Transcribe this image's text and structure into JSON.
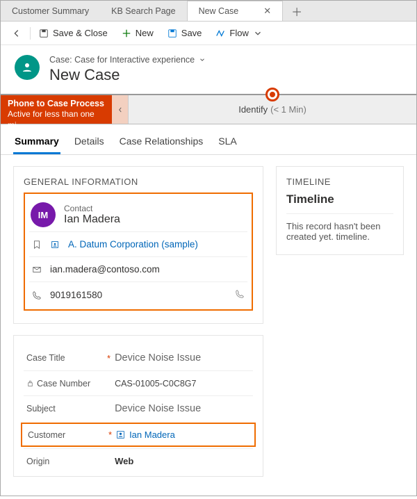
{
  "tabs": {
    "t1": "Customer Summary",
    "t2": "KB Search Page",
    "t3": "New Case"
  },
  "commands": {
    "save_close": "Save & Close",
    "new": "New",
    "save": "Save",
    "flow": "Flow"
  },
  "header": {
    "breadcrumb": "Case: Case for Interactive experience",
    "title": "New Case"
  },
  "process": {
    "name": "Phone to Case Process",
    "status": "Active for less than one mi...",
    "stage_label": "Identify",
    "stage_time": "(< 1 Min)"
  },
  "inner_tabs": {
    "summary": "Summary",
    "details": "Details",
    "rel": "Case Relationships",
    "sla": "SLA"
  },
  "general": {
    "title": "GENERAL INFORMATION",
    "contact_label": "Contact",
    "contact_initials": "IM",
    "contact_name": "Ian Madera",
    "company": "A. Datum Corporation (sample)",
    "email": "ian.madera@contoso.com",
    "phone": "9019161580"
  },
  "form": {
    "case_title_label": "Case Title",
    "case_title_value": "Device Noise Issue",
    "case_number_label": "Case Number",
    "case_number_value": "CAS-01005-C0C8G7",
    "subject_label": "Subject",
    "subject_value": "Device Noise Issue",
    "customer_label": "Customer",
    "customer_value": "Ian Madera",
    "origin_label": "Origin",
    "origin_value": "Web"
  },
  "timeline": {
    "section": "TIMELINE",
    "heading": "Timeline",
    "body": "This record hasn't been created yet. timeline."
  }
}
